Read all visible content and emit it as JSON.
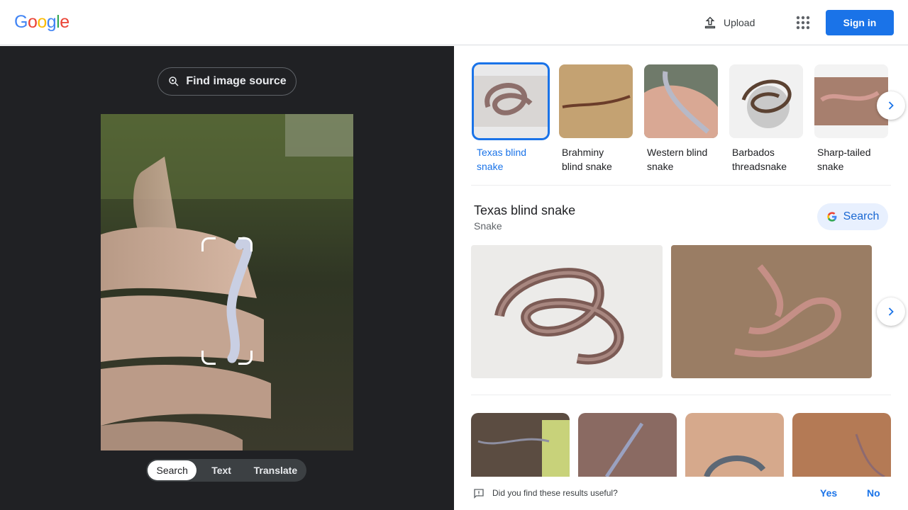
{
  "brand": {
    "logo_letters": [
      "G",
      "o",
      "o",
      "g",
      "l",
      "e"
    ],
    "logo_colors": [
      "#4285F4",
      "#EA4335",
      "#FBBC05",
      "#4285F4",
      "#34A853",
      "#EA4335"
    ]
  },
  "header": {
    "upload_label": "Upload",
    "signin_label": "Sign in"
  },
  "left": {
    "find_source_label": "Find image source",
    "modes": [
      "Search",
      "Text",
      "Translate"
    ],
    "active_mode": "Search"
  },
  "matches": [
    {
      "line1": "Texas blind",
      "line2": "snake",
      "selected": true
    },
    {
      "line1": "Brahminy",
      "line2": "blind snake",
      "selected": false
    },
    {
      "line1": "Western blind",
      "line2": "snake",
      "selected": false
    },
    {
      "line1": "Barbados",
      "line2": "threadsnake",
      "selected": false
    },
    {
      "line1": "Sharp-tailed",
      "line2": "snake",
      "selected": false
    }
  ],
  "entity": {
    "title": "Texas blind snake",
    "subtitle": "Snake",
    "search_label": "Search"
  },
  "feedback": {
    "question": "Did you find these results useful?",
    "yes": "Yes",
    "no": "No"
  },
  "colors": {
    "accent": "#1a73e8",
    "dark_panel": "#202124"
  }
}
